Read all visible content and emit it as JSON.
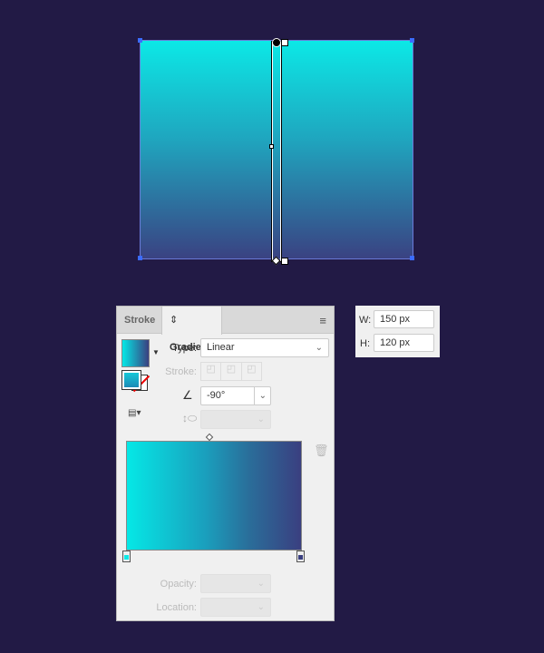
{
  "canvas": {
    "gradient_top": "#0ce8e6",
    "gradient_bottom": "#3a4282"
  },
  "panel": {
    "tabs": [
      {
        "label": "Stroke"
      },
      {
        "label": "Gradient"
      }
    ],
    "type_label": "Type:",
    "type_value": "Linear",
    "stroke_label": "Stroke:",
    "angle_value": "-90°",
    "opacity_label": "Opacity:",
    "location_label": "Location:",
    "stops": [
      {
        "color": "#0ce8e6",
        "location": 0
      },
      {
        "color": "#3a3f80",
        "location": 100
      }
    ],
    "midpoint": 50
  },
  "dimensions": {
    "w_label": "W:",
    "w_value": "150 px",
    "h_label": "H:",
    "h_value": "120 px"
  }
}
